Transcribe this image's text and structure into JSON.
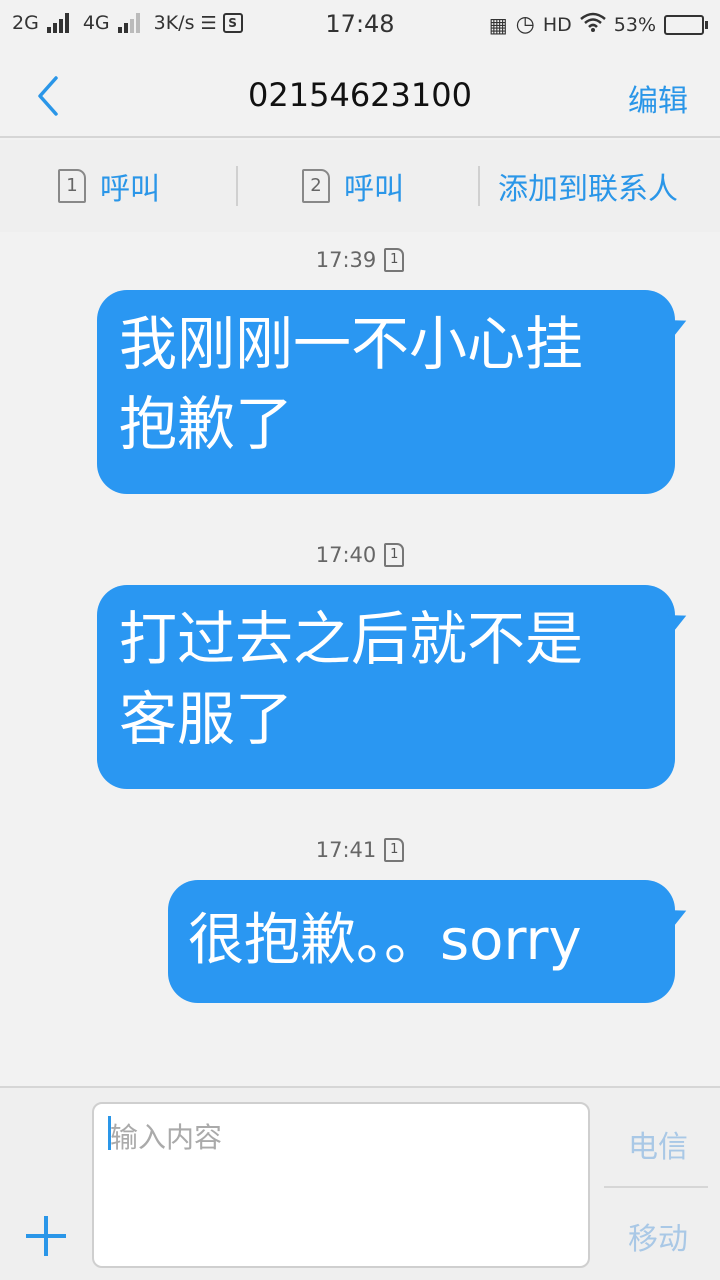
{
  "status_bar": {
    "net1": "2G",
    "net2": "4G",
    "speed": "3K/s",
    "time": "17:48",
    "hd": "HD",
    "battery": "53%",
    "battery_level": 0.53
  },
  "header": {
    "title": "02154623100",
    "edit_label": "编辑"
  },
  "actions": {
    "call1_sim": "1",
    "call1_label": "呼叫",
    "call2_sim": "2",
    "call2_label": "呼叫",
    "add_contact_label": "添加到联系人"
  },
  "messages": [
    {
      "time": "17:39",
      "sim": "1",
      "text": "我刚刚一不小心挂\n抱歉了"
    },
    {
      "time": "17:40",
      "sim": "1",
      "text": "打过去之后就不是\n客服了"
    },
    {
      "time": "17:41",
      "sim": "1",
      "text": "很抱歉。。sorry"
    }
  ],
  "composer": {
    "placeholder": "输入内容",
    "send1_label": "电信",
    "send2_label": "移动"
  },
  "colors": {
    "accent": "#2a96e8",
    "bubble": "#2a97f2",
    "background": "#f2f2f2"
  }
}
